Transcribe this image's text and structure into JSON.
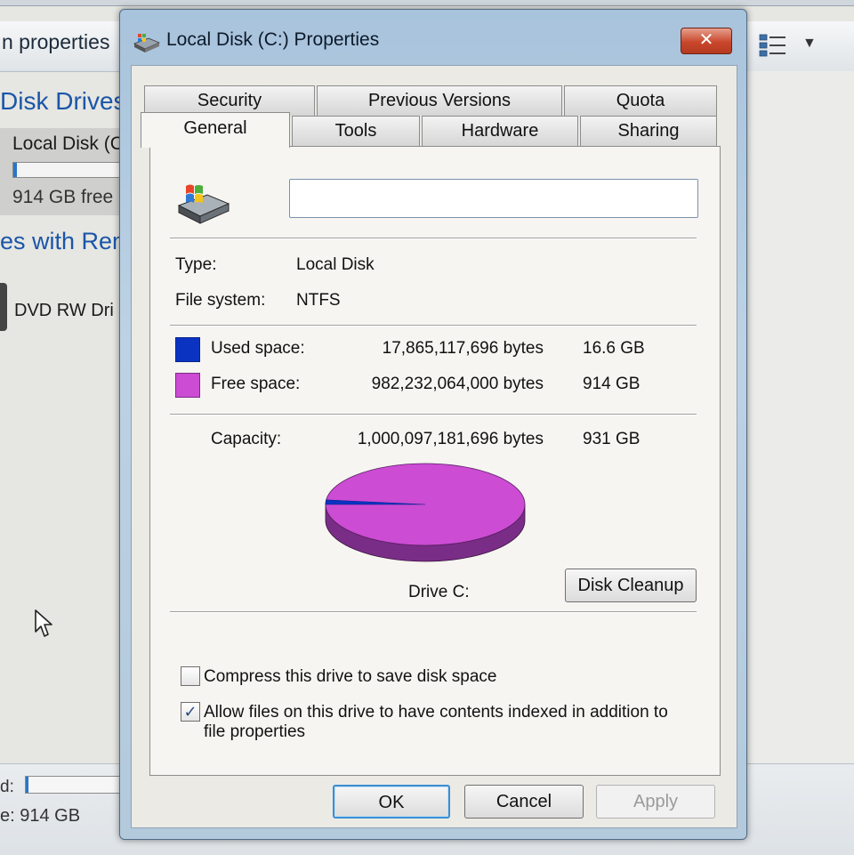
{
  "background": {
    "title": "n properties",
    "heading_hdd": "Disk Drives",
    "drive_name": "Local Disk (C",
    "drive_free": "914 GB free",
    "heading_removable": "es with Rem",
    "dvd_label": "DVD RW Dri",
    "status_used_label": "d:",
    "status_free": "e: 914 GB"
  },
  "dialog": {
    "title": "Local Disk (C:) Properties",
    "close_label": "✕",
    "tabs_back": [
      {
        "label": "Security"
      },
      {
        "label": "Previous Versions"
      },
      {
        "label": "Quota"
      }
    ],
    "tabs_front": [
      {
        "label": "General",
        "active": true
      },
      {
        "label": "Tools"
      },
      {
        "label": "Hardware"
      },
      {
        "label": "Sharing"
      }
    ],
    "general": {
      "volume_label_value": "",
      "type_label": "Type:",
      "type_value": "Local Disk",
      "fs_label": "File system:",
      "fs_value": "NTFS",
      "used_label": "Used space:",
      "used_bytes": "17,865,117,696 bytes",
      "used_size": "16.6 GB",
      "free_label": "Free space:",
      "free_bytes": "982,232,064,000 bytes",
      "free_size": "914 GB",
      "capacity_label": "Capacity:",
      "capacity_bytes": "1,000,097,181,696 bytes",
      "capacity_size": "931 GB",
      "drive_caption": "Drive C:",
      "cleanup_label": "Disk Cleanup",
      "compress_label": "Compress this drive to save disk space",
      "compress_checked": false,
      "index_label_line1": "Allow files on this drive to have contents indexed in addition to",
      "index_label_line2": "file properties",
      "index_checked": true
    },
    "buttons": {
      "ok": "OK",
      "cancel": "Cancel",
      "apply": "Apply"
    }
  },
  "colors": {
    "used": "#0b33c2",
    "free": "#cc4cd3",
    "used_side": "#0a248a",
    "free_side": "#7a2d86"
  },
  "chart_data": {
    "type": "pie",
    "categories": [
      "Used space",
      "Free space"
    ],
    "values": [
      17865117696,
      982232064000
    ]
  }
}
